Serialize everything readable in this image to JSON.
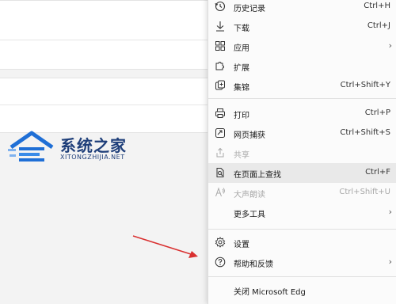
{
  "menu": {
    "items": [
      {
        "label": "历史记录",
        "shortcut": "Ctrl+H",
        "icon": "history-icon"
      },
      {
        "label": "下载",
        "shortcut": "Ctrl+J",
        "icon": "download-icon"
      },
      {
        "label": "应用",
        "shortcut": "",
        "icon": "apps-icon"
      },
      {
        "label": "扩展",
        "shortcut": "",
        "icon": "extensions-icon"
      },
      {
        "label": "集锦",
        "shortcut": "Ctrl+Shift+Y",
        "icon": "collections-icon"
      },
      {
        "label": "打印",
        "shortcut": "Ctrl+P",
        "icon": "print-icon"
      },
      {
        "label": "网页捕获",
        "shortcut": "Ctrl+Shift+S",
        "icon": "web-capture-icon"
      },
      {
        "label": "共享",
        "shortcut": "",
        "icon": "share-icon"
      },
      {
        "label": "在页面上查找",
        "shortcut": "Ctrl+F",
        "icon": "find-icon"
      },
      {
        "label": "大声朗读",
        "shortcut": "Ctrl+Shift+U",
        "icon": "read-aloud-icon"
      },
      {
        "label": "更多工具",
        "shortcut": "",
        "icon": ""
      },
      {
        "label": "设置",
        "shortcut": "",
        "icon": "settings-icon"
      },
      {
        "label": "帮助和反馈",
        "shortcut": "",
        "icon": "help-icon"
      },
      {
        "label": "关闭 Microsoft Edg",
        "shortcut": "",
        "icon": ""
      }
    ]
  },
  "watermark": {
    "title": "系统之家",
    "subtitle": "XITONGZHIJIA.NET"
  },
  "colors": {
    "highlight": "#e9e9e9",
    "arrow": "#d93030",
    "watermark": "#1f3f7a"
  }
}
